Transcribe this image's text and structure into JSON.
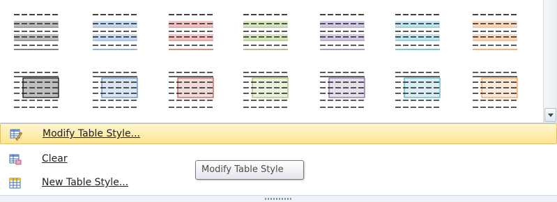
{
  "gallery": {
    "rows": [
      {
        "variant": "banded",
        "swatches": [
          {
            "name": "plain-table-1",
            "color": "#3a3a3a",
            "fill": "#bfbfbf"
          },
          {
            "name": "light-shading-accent-1",
            "color": "#5b87c6",
            "fill": "#c6d9f1"
          },
          {
            "name": "light-shading-accent-2",
            "color": "#c0504d",
            "fill": "#f2c4c3"
          },
          {
            "name": "light-shading-accent-3",
            "color": "#79a33c",
            "fill": "#d7e7bd"
          },
          {
            "name": "light-shading-accent-4",
            "color": "#7d62a3",
            "fill": "#d6cbe5"
          },
          {
            "name": "light-shading-accent-5",
            "color": "#3f9eb7",
            "fill": "#c3e5ee"
          },
          {
            "name": "light-shading-accent-6",
            "color": "#e5873d",
            "fill": "#fad9bf"
          }
        ]
      },
      {
        "variant": "boxed",
        "swatches": [
          {
            "name": "light-list",
            "color": "#000000",
            "fill": "#bfbfbf"
          },
          {
            "name": "light-list-accent-1",
            "color": "#4f81bd",
            "fill": "#dbe5f1"
          },
          {
            "name": "light-list-accent-2",
            "color": "#c0504d",
            "fill": "#f2dcdb"
          },
          {
            "name": "light-list-accent-3",
            "color": "#9bbb59",
            "fill": "#ebf1dd"
          },
          {
            "name": "light-list-accent-4",
            "color": "#8064a2",
            "fill": "#e5e0ec"
          },
          {
            "name": "light-list-accent-5",
            "color": "#4bacc6",
            "fill": "#dbeef3"
          },
          {
            "name": "light-list-accent-6",
            "color": "#f79646",
            "fill": "#fde9d9"
          }
        ]
      }
    ]
  },
  "menu": {
    "items": [
      {
        "label": "Modify Table Style...",
        "hover": true,
        "icon": "modify-table-style-icon"
      },
      {
        "label": "Clear",
        "hover": false,
        "icon": "clear-table-style-icon"
      },
      {
        "label": "New Table Style...",
        "hover": false,
        "icon": "new-table-style-icon"
      }
    ]
  },
  "tooltip": {
    "text": "Modify Table Style"
  },
  "colors": {
    "hover_bg": "#ffe592",
    "hover_border": "#e3c168"
  }
}
